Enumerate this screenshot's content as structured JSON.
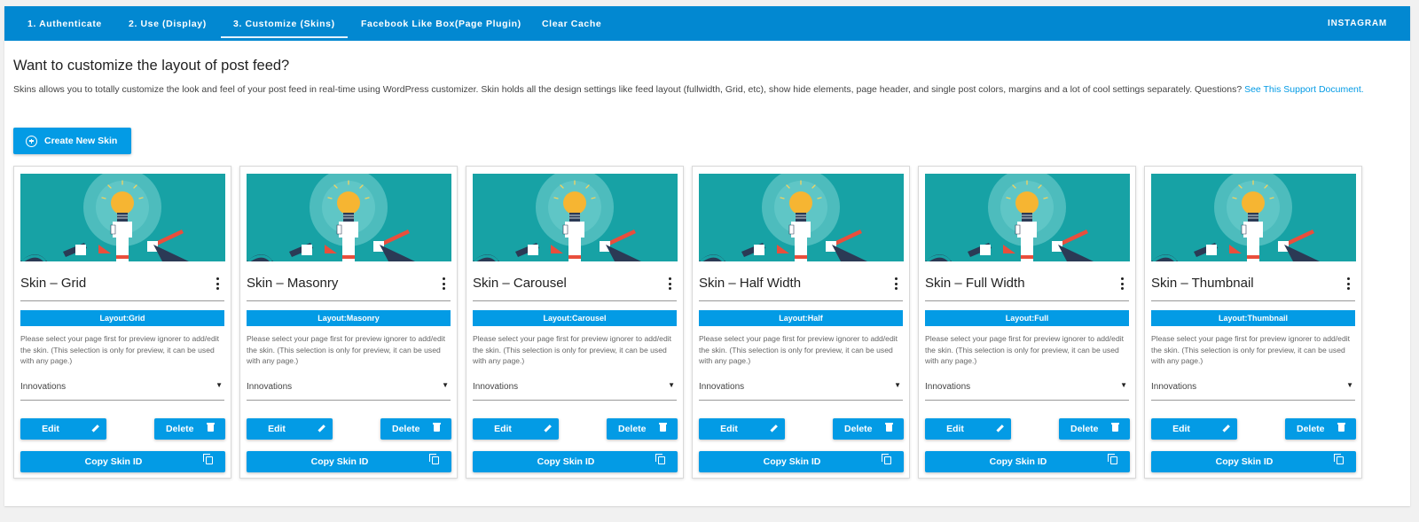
{
  "tabs": [
    {
      "label": "1. Authenticate"
    },
    {
      "label": "2. Use (Display)"
    },
    {
      "label": "3. Customize (Skins)"
    },
    {
      "label": "Facebook Like Box(Page Plugin)"
    },
    {
      "label": "Clear Cache"
    }
  ],
  "brand": "INSTAGRAM",
  "heading": "Want to customize the layout of post feed?",
  "description": {
    "text": "Skins allows you to totally customize the look and feel of your post feed in real-time using WordPress customizer. Skin holds all the design settings like feed layout (fullwidth, Grid, etc), show hide elements, page header, and single post colors, margins and a lot of cool settings separately. Questions? ",
    "link": "See This Support Document."
  },
  "create_button": "Create New Skin",
  "colors": {
    "topbar": "#0288d1",
    "accent": "#039be5",
    "thumbnail_bg": "#17a2a5"
  },
  "skin_card": {
    "note": "Please select your page first for preview ignorer to add/edit the skin. (This selection is only for preview, it can be used with any page.)",
    "edit_label": "Edit",
    "delete_label": "Delete",
    "copy_label": "Copy Skin ID",
    "image_icon": "lightbulb-illustration"
  },
  "skins": [
    {
      "title": "Skin – Grid",
      "layout": "Layout:Grid",
      "page": "Innovations"
    },
    {
      "title": "Skin – Masonry",
      "layout": "Layout:Masonry",
      "page": "Innovations"
    },
    {
      "title": "Skin – Carousel",
      "layout": "Layout:Carousel",
      "page": "Innovations"
    },
    {
      "title": "Skin – Half Width",
      "layout": "Layout:Half",
      "page": "Innovations"
    },
    {
      "title": "Skin – Full Width",
      "layout": "Layout:Full",
      "page": "Innovations"
    },
    {
      "title": "Skin – Thumbnail",
      "layout": "Layout:Thumbnail",
      "page": "Innovations"
    }
  ]
}
